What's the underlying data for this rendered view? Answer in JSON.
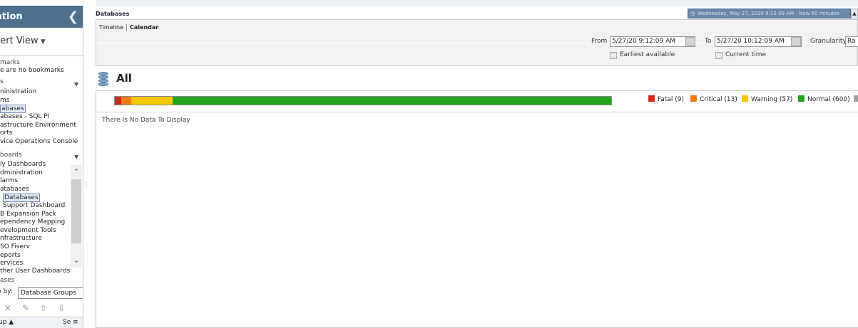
{
  "sidebar": {
    "header": "ation",
    "view": "pert View",
    "bookmarks_header": "marks",
    "bookmarks_empty": "e are no bookmarks",
    "pages_header": "s",
    "pages": [
      "ninistration",
      "ms",
      "abases",
      "abases - SQL PI",
      "astructure Environment",
      "orts",
      "vice Operations Console"
    ],
    "dashboards_header": "boards",
    "dashboards": [
      "ly Dashboards",
      "dministration",
      "larms",
      "atabases",
      "Databases",
      "Support Dashboard",
      "B Expansion Pack",
      "ependency Mapping",
      "evelopment Tools",
      "nfrastructure",
      "SO Fiserv",
      "eports",
      "ervices",
      "ther User Dashboards"
    ],
    "databases_header": "ases",
    "group_by_label": "p by:",
    "group_by_value": "Database Groups",
    "column_group": "up",
    "column_severity": "Se"
  },
  "main": {
    "page_title": "Databases",
    "time_range_pill": "Wednesday, May 27, 2020 9:12:09 AM - Now 60 minutes",
    "tabs": [
      "Timeline",
      "Calendar"
    ],
    "from_label": "From",
    "from_value": "5/27/20 9:12:09 AM",
    "to_label": "To",
    "to_value": "5/27/20 10:12:09 AM",
    "granularity_label": "Granularity",
    "granularity_value": "Ra",
    "earliest_label": "Earliest available",
    "current_time_label": "Current time",
    "section_title": "All",
    "no_data": "There Is No Data To Display"
  },
  "status": {
    "legend": [
      {
        "label": "Fatal",
        "count": "(9)",
        "color": "#d9261c"
      },
      {
        "label": "Critical",
        "count": "(13)",
        "color": "#f07d14"
      },
      {
        "label": "Warning",
        "count": "(57)",
        "color": "#f5c800"
      },
      {
        "label": "Normal",
        "count": "(600)",
        "color": "#25a31c"
      }
    ],
    "counts": [
      9,
      13,
      57,
      600
    ],
    "overflow_swatch_color": "#a0a0a0"
  },
  "icons": {
    "collapse": "chevron-left-icon",
    "database": "database-icon",
    "calendar": "calendar-icon",
    "scroll_up": "chevron-up-icon",
    "scroll_down": "chevron-down-icon"
  }
}
